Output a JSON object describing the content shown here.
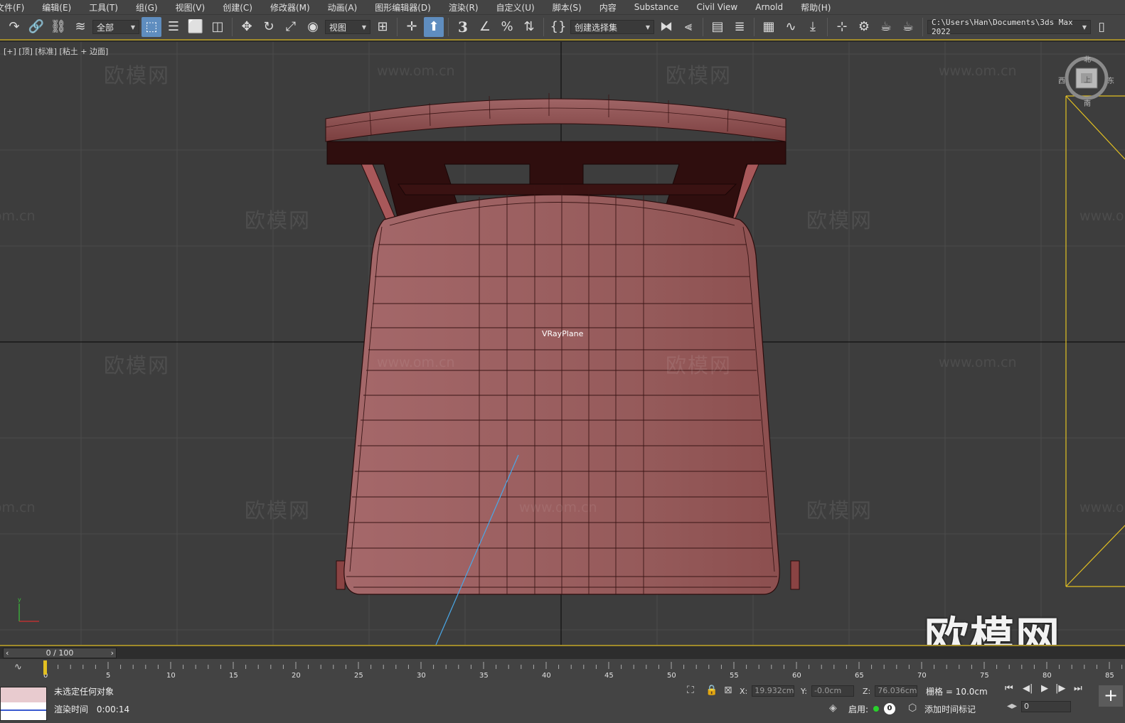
{
  "menu": [
    {
      "label": "文件(F)"
    },
    {
      "label": "编辑(E)"
    },
    {
      "label": "工具(T)"
    },
    {
      "label": "组(G)"
    },
    {
      "label": "视图(V)"
    },
    {
      "label": "创建(C)"
    },
    {
      "label": "修改器(M)"
    },
    {
      "label": "动画(A)"
    },
    {
      "label": "图形编辑器(D)"
    },
    {
      "label": "渲染(R)"
    },
    {
      "label": "自定义(U)"
    },
    {
      "label": "脚本(S)"
    },
    {
      "label": "内容"
    },
    {
      "label": "Substance"
    },
    {
      "label": "Civil View"
    },
    {
      "label": "Arnold"
    },
    {
      "label": "帮助(H)"
    }
  ],
  "toolbar": {
    "filter_value": "全部",
    "refcoord_value": "视图",
    "selection_set_value": "创建选择集",
    "project_path": "C:\\Users\\Han\\Documents\\3ds Max 2022",
    "snap_label": "3"
  },
  "viewport": {
    "label": "[+] [顶] [标准] [粘土 + 边面]",
    "object_label": "VRayPlane",
    "watermark_text": "欧模网",
    "watermark_url": "www.om.cn",
    "big_watermark": "欧模网",
    "viewcube": {
      "north": "北",
      "south": "南",
      "east": "东",
      "west": "西",
      "face": "上"
    }
  },
  "timeline": {
    "slider_value": "0 / 100",
    "ticks": [
      "0",
      "5",
      "10",
      "15",
      "20",
      "25",
      "30",
      "35",
      "40",
      "45",
      "50",
      "55",
      "60",
      "65",
      "70",
      "75",
      "80",
      "85"
    ]
  },
  "status": {
    "selection_text": "未选定任何对象",
    "render_time_label": "渲染时间",
    "render_time_value": "0:00:14",
    "x_label": "X:",
    "x_value": "19.932cm",
    "y_label": "Y:",
    "y_value": "-0.0cm",
    "z_label": "Z:",
    "z_value": "76.036cm",
    "grid_text": "栅格 = 10.0cm",
    "enable_label": "启用:",
    "enable_count": "0",
    "add_time_tag": "添加时间标记",
    "frame_value": "0"
  },
  "colors": {
    "viewport_bg": "#3d3d3d",
    "chair_face": "#9a5b5c",
    "chair_dark": "#2e0d0d",
    "selection_yellow": "#e3c021",
    "accent_blue": "#5f8dbf"
  }
}
